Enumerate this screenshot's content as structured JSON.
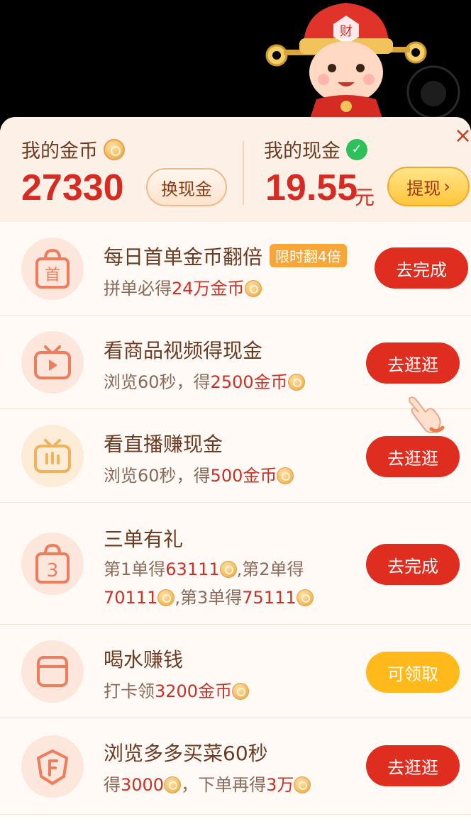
{
  "wallet": {
    "coins_label": "我的金币",
    "coins_value": "27330",
    "exchange_button": "换现金",
    "cash_label": "我的现金",
    "cash_value": "19.55",
    "cash_unit": "元",
    "withdraw_button": "提现",
    "close": "×"
  },
  "tasks": [
    {
      "icon": "bag-first-icon",
      "title": "每日首单金币翻倍",
      "tag": "限时翻4倍",
      "desc_prefix": "拼单必得",
      "desc_highlight": "24万金币",
      "button": "去完成"
    },
    {
      "icon": "tv-video-icon",
      "title": "看商品视频得现金",
      "desc_prefix": "浏览60秒，得",
      "desc_highlight": "2500金币",
      "button": "去逛逛"
    },
    {
      "icon": "tv-live-icon",
      "title": "看直播赚现金",
      "desc_prefix": "浏览60秒，得",
      "desc_highlight": "500金币",
      "button": "去逛逛"
    },
    {
      "icon": "bag-three-icon",
      "title": "三单有礼",
      "desc_line1_a": "第1单得",
      "desc_line1_b": "63111",
      "desc_line1_c": ",第2单得",
      "desc_line2_a": "70111",
      "desc_line2_b": ",第3单得",
      "desc_line2_c": "75111",
      "button": "去完成"
    },
    {
      "icon": "cup-icon",
      "title": "喝水赚钱",
      "desc_prefix": "打卡领",
      "desc_highlight": "3200金币",
      "button": "可领取"
    },
    {
      "icon": "vegetable-icon",
      "title": "浏览多多买菜60秒",
      "desc_a": "得",
      "desc_b": "3000",
      "desc_c": "，下单再得",
      "desc_d": "3万",
      "button": "去逛逛"
    }
  ],
  "colors": {
    "primary_red": "#df2d20",
    "highlight_red": "#c83227",
    "yellow_button": "#ffb91a",
    "title_brown": "#6b3a22"
  }
}
